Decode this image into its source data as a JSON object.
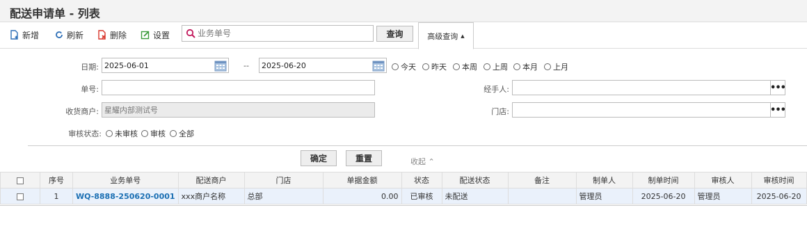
{
  "title": "配送申请单 - 列表",
  "toolbar": {
    "new_label": "新增",
    "refresh_label": "刷新",
    "delete_label": "删除",
    "settings_label": "设置",
    "search_placeholder": "业务单号",
    "query_label": "查询",
    "advanced_label": "高级查询"
  },
  "filters": {
    "date_label": "日期:",
    "date_from": "2025-06-01",
    "date_sep": "--",
    "date_to": "2025-06-20",
    "quick_dates": [
      "今天",
      "昨天",
      "本周",
      "上周",
      "本月",
      "上月"
    ],
    "order_label": "单号:",
    "order_value": "",
    "handler_label": "经手人:",
    "handler_value": "",
    "receiver_label": "收货商户:",
    "receiver_value": "星耀内部测试号",
    "store_label": "门店:",
    "store_value": "",
    "audit_label": "审核状态:",
    "audit_options": [
      "未审核",
      "审核",
      "全部"
    ]
  },
  "actions": {
    "confirm_label": "确定",
    "reset_label": "重置",
    "collapse_label": "收起"
  },
  "table": {
    "headers": [
      "序号",
      "业务单号",
      "配送商户",
      "门店",
      "单据金额",
      "状态",
      "配送状态",
      "备注",
      "制单人",
      "制单时间",
      "审核人",
      "审核时间"
    ],
    "rows": [
      {
        "index": "1",
        "order_no": "WQ-8888-250620-0001",
        "merchant": "xxx商户名称",
        "store": "总部",
        "amount": "0.00",
        "status": "已审核",
        "delivery_status": "未配送",
        "remark": "",
        "creator": "管理员",
        "created_at": "2025-06-20",
        "auditor": "管理员",
        "audited_at": "2025-06-20"
      }
    ]
  },
  "colors": {
    "link": "#1b6fb3",
    "row_bg": "#eaf1fb",
    "header_bg": "#f3f3f3",
    "new_icon": "#2e6fb7",
    "delete_icon": "#d9352b",
    "settings_icon": "#3a9a3a",
    "search_icon": "#c2185b"
  }
}
